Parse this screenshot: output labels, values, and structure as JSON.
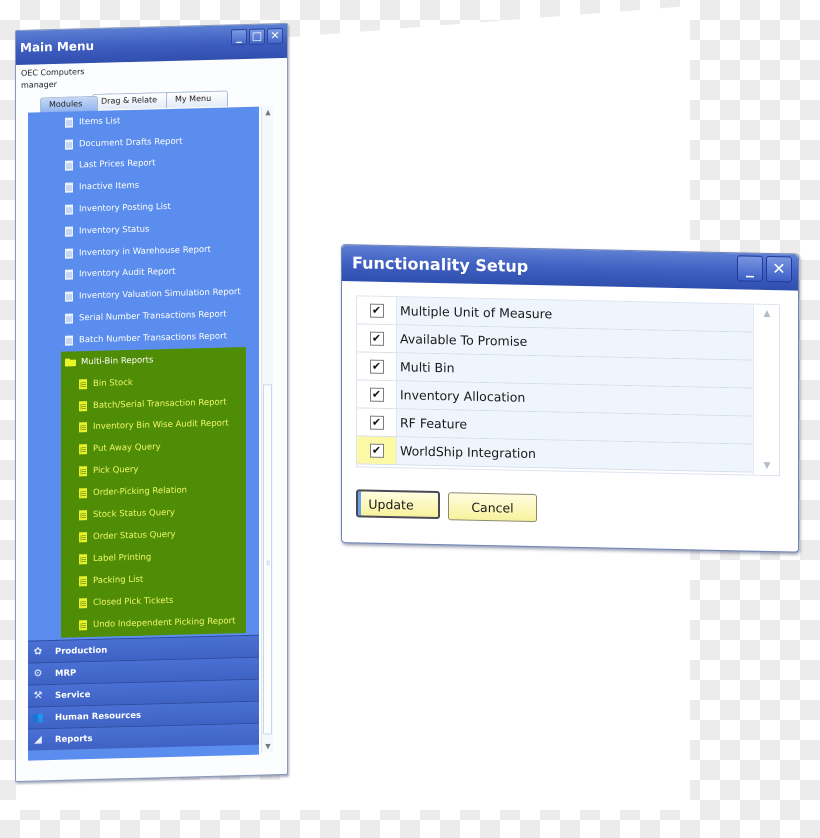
{
  "main_menu": {
    "title": "Main Menu",
    "company": "OEC Computers",
    "user": "manager",
    "window_buttons": {
      "minimize": "_",
      "maximize": "□",
      "close": "✕"
    },
    "tabs": [
      {
        "label": "Modules",
        "active": true
      },
      {
        "label": "Drag & Relate",
        "active": false
      },
      {
        "label": "My Menu",
        "active": false
      }
    ],
    "tree_items": [
      "Items List",
      "Document Drafts Report",
      "Last Prices Report",
      "Inactive Items",
      "Inventory Posting List",
      "Inventory Status",
      "Inventory in Warehouse Report",
      "Inventory Audit Report",
      "Inventory Valuation Simulation Report",
      "Serial Number Transactions Report",
      "Batch Number Transactions Report"
    ],
    "multi_bin": {
      "folder_label": "Multi-Bin Reports",
      "items": [
        "Bin Stock",
        "Batch/Serial Transaction Report",
        "Inventory Bin Wise Audit Report",
        "Put Away Query",
        "Pick Query",
        "Order-Picking Relation",
        "Stock Status Query",
        "Order Status Query",
        "Label Printing",
        "Packing List",
        "Closed Pick Tickets",
        "Undo Independent Picking Report"
      ]
    },
    "modules": [
      {
        "label": "Production",
        "icon": "gear-icon",
        "glyph": "✿"
      },
      {
        "label": "MRP",
        "icon": "mrp-icon",
        "glyph": "⚙"
      },
      {
        "label": "Service",
        "icon": "wrench-icon",
        "glyph": "⚒"
      },
      {
        "label": "Human Resources",
        "icon": "people-icon",
        "glyph": "👥"
      },
      {
        "label": "Reports",
        "icon": "chart-icon",
        "glyph": "◢"
      }
    ],
    "scroll": {
      "up": "▲",
      "down": "▼",
      "grip": "⠿"
    }
  },
  "functionality_setup": {
    "title": "Functionality Setup",
    "window_buttons": {
      "minimize": "_",
      "close": "✕"
    },
    "features": [
      {
        "label": "Multiple Unit of Measure",
        "checked": true
      },
      {
        "label": "Available To Promise",
        "checked": true
      },
      {
        "label": "Multi Bin",
        "checked": true
      },
      {
        "label": "Inventory Allocation",
        "checked": true
      },
      {
        "label": "RF Feature",
        "checked": true
      },
      {
        "label": "WorldShip Integration",
        "checked": true
      }
    ],
    "check_glyph": "✔",
    "scroll": {
      "up": "▲",
      "down": "▼"
    },
    "update_label": "Update",
    "cancel_label": "Cancel"
  }
}
